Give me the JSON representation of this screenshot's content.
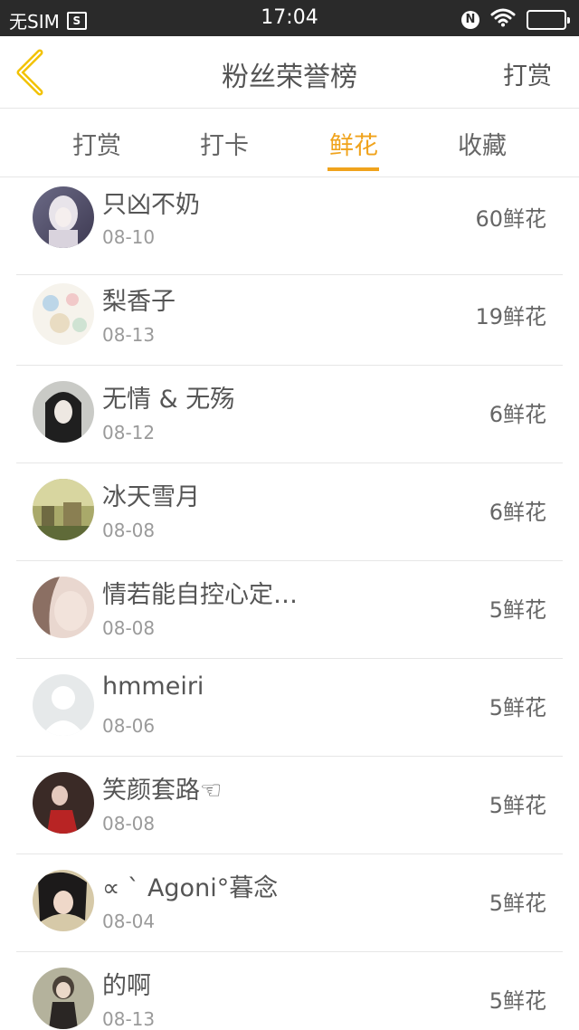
{
  "status_bar": {
    "carrier": "无SIM",
    "sim_icon_text": "S",
    "time": "17:04",
    "nfc_icon_text": "N"
  },
  "header": {
    "title": "粉丝荣誉榜",
    "right_action": "打赏"
  },
  "tabs": [
    {
      "label": "打赏",
      "active": false
    },
    {
      "label": "打卡",
      "active": false
    },
    {
      "label": "鲜花",
      "active": true
    },
    {
      "label": "收藏",
      "active": false
    }
  ],
  "colors": {
    "accent": "#f0a31c",
    "back_arrow": "#f2c200"
  },
  "fans": [
    {
      "name": "只凶不奶",
      "date": "08-10",
      "count": "60鲜花"
    },
    {
      "name": "梨香子",
      "date": "08-13",
      "count": "19鲜花"
    },
    {
      "name": "无情 & 无殇",
      "date": "08-12",
      "count": "6鲜花"
    },
    {
      "name": "冰天雪月",
      "date": "08-08",
      "count": "6鲜花"
    },
    {
      "name": "情若能自控心定…",
      "date": "08-08",
      "count": "5鲜花"
    },
    {
      "name": "hmmeiri",
      "date": "08-06",
      "count": "5鲜花"
    },
    {
      "name": "笑颜套路☜",
      "date": "08-08",
      "count": "5鲜花"
    },
    {
      "name": "∝ ˋ Agoni°暮念",
      "date": "08-04",
      "count": "5鲜花"
    },
    {
      "name": "的啊",
      "date": "08-13",
      "count": "5鲜花"
    }
  ]
}
